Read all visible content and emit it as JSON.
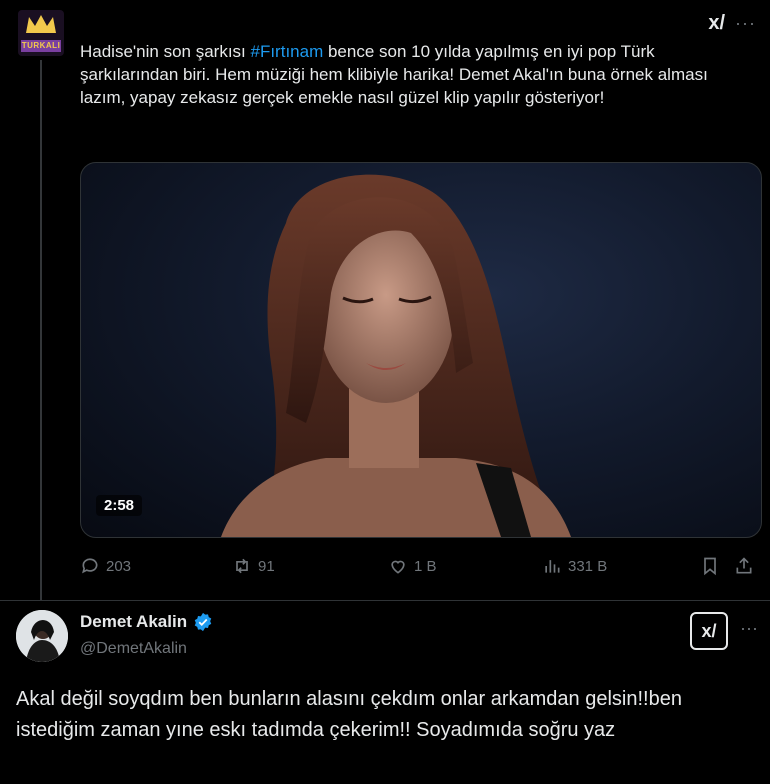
{
  "tweet1": {
    "avatar_tag": "TURKALI",
    "text_before": "Hadise'nin son şarkısı ",
    "hashtag": "#Fırtınam",
    "text_after": " bence son 10 yılda yapılmış en iyi pop Türk şarkılarından biri. Hem müziği hem klibiyle harika! Demet Akal'ın buna örnek alması lazım, yapay zekasız gerçek emekle nasıl güzel klip yapılır gösteriyor!",
    "video_duration": "2:58",
    "stats": {
      "replies": "203",
      "reposts": "91",
      "likes": "1 B",
      "views": "331 B"
    }
  },
  "tweet2": {
    "name": "Demet Akalin",
    "handle": "@DemetAkalin",
    "text": "Akal değil soyqdım ben bunların alasını çekdım onlar arkamdan gelsin!!ben istediğim zaman yıne eskı tadımda çekerim!! Soyadımıda soğru yaz"
  },
  "colors": {
    "accent": "#1d9bf0",
    "muted": "#71767b",
    "background": "#000000"
  },
  "icons": [
    "reply-icon",
    "repost-icon",
    "like-icon",
    "views-icon",
    "bookmark-icon",
    "share-icon",
    "verified-icon",
    "x-logo-icon",
    "more-icon"
  ]
}
